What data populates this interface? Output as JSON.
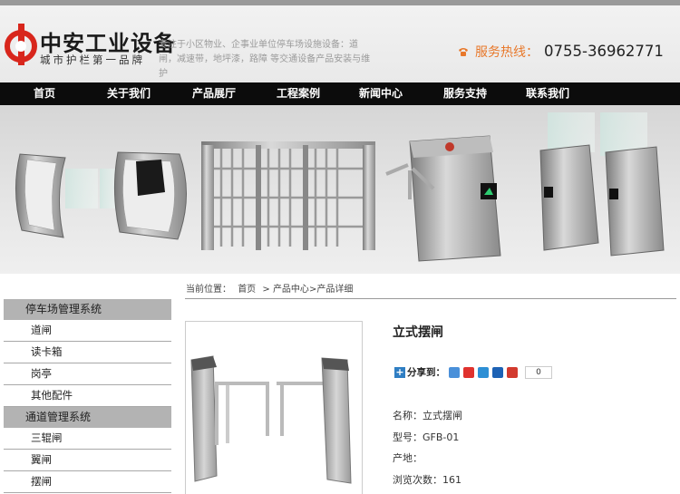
{
  "brand": {
    "title": "中安工业设备",
    "subtitle": "城市护栏第一品牌",
    "slogan": "专注于小区物业、企事业单位停车场设施设备：道闸，减速带，地坪漆，路障 等交通设备产品安装与维护"
  },
  "hotline": {
    "label": "服务热线：",
    "number": "0755-36962771",
    "icon": "phone-icon",
    "color": "#e8782a"
  },
  "nav": [
    "首页",
    "关于我们",
    "产品展厅",
    "工程案例",
    "新闻中心",
    "服务支持",
    "联系我们"
  ],
  "breadcrumb": {
    "prefix": "当前位置：",
    "home": "首页",
    "sep1": "> ",
    "level1": "产品中心",
    "sep2": ">",
    "current": "产品详细"
  },
  "sidebar": [
    {
      "label": "停车场管理系统",
      "items": [
        "道闸",
        "读卡箱",
        "岗亭",
        "其他配件"
      ]
    },
    {
      "label": "通道管理系统",
      "items": [
        "三辊闸",
        "翼闸",
        "摆闸"
      ]
    }
  ],
  "product": {
    "title": "立式摆闸",
    "share_label": "分享到：",
    "share_count": "0",
    "specs": [
      {
        "key": "名称：",
        "value": "立式摆闸"
      },
      {
        "key": "型号：",
        "value": "GFB-01"
      },
      {
        "key": "产地：",
        "value": ""
      },
      {
        "key": "浏览次数：",
        "value": "161"
      }
    ]
  },
  "colors": {
    "nav_bg": "#0c0c0c",
    "sidebar_cat": "#b3b3b3",
    "logo_red": "#d8261c"
  }
}
